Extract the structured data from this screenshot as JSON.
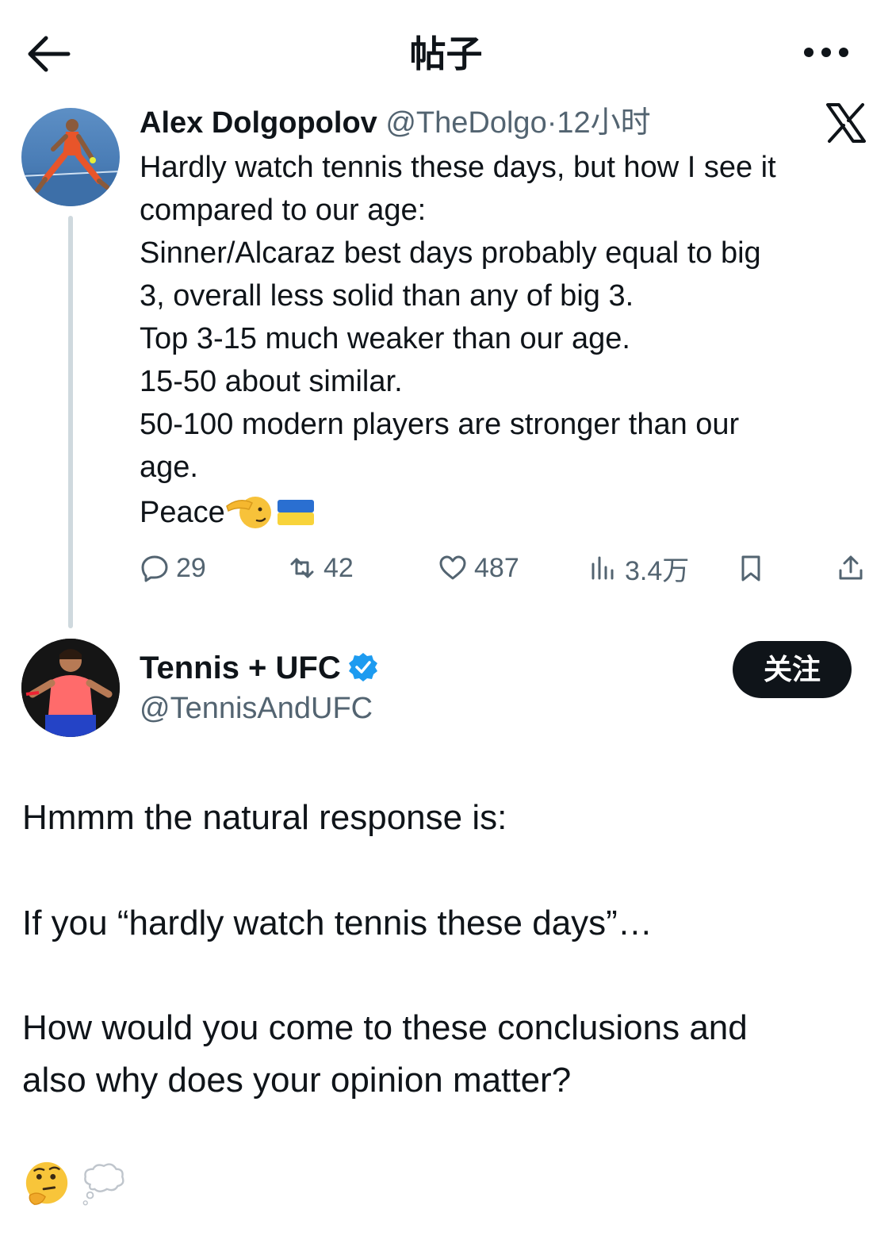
{
  "header": {
    "title": "帖子",
    "back_icon": "arrow-left-icon",
    "more_icon": "more-horizontal-icon"
  },
  "tweet1": {
    "name": "Alex Dolgopolov",
    "handle": "@TheDolgo",
    "separator": "·",
    "time": "12小时",
    "platform_icon": "x-logo-icon",
    "lines": [
      "Hardly watch tennis these days, but how I see it",
      "compared to our age:",
      "Sinner/Alcaraz best days probably equal to big",
      "3, overall less solid than any of big 3.",
      "Top 3-15 much weaker than our age.",
      "15-50 about similar.",
      "50-100 modern players are stronger than our",
      "age.",
      "Peace"
    ],
    "peace_emojis": [
      "saluting-face-icon",
      "ukraine-flag-icon"
    ],
    "actions": {
      "replies": "29",
      "reposts": "42",
      "likes": "487",
      "views": "3.4万"
    }
  },
  "tweet2": {
    "name": "Tennis + UFC",
    "handle": "@TennisAndUFC",
    "follow_label": "关注",
    "lines": [
      "Hmmm the natural response is:",
      "If you “hardly watch tennis these days”…",
      "How would you come to these conclusions and",
      "also why does your opinion matter?"
    ],
    "emojis": [
      "thinking-face-icon",
      "thought-balloon-icon"
    ]
  },
  "colors": {
    "text": "#0f1419",
    "secondary": "#536471",
    "verified": "#1d9bf0",
    "thread_line": "#cfd9de"
  }
}
